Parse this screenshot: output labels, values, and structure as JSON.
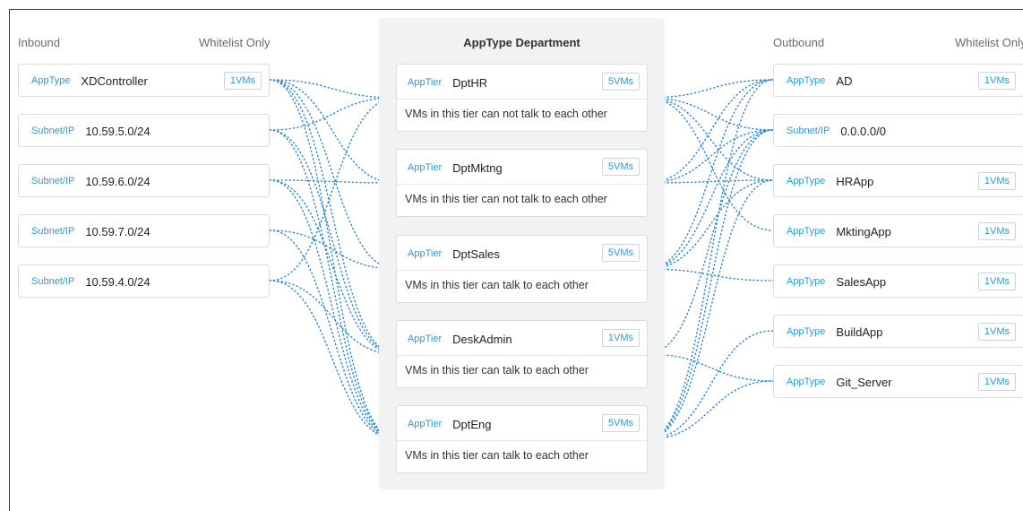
{
  "inbound": {
    "heading": "Inbound",
    "whitelist_label": "Whitelist Only",
    "items": [
      {
        "tag": "AppType",
        "name": "XDController",
        "vms": "1VMs"
      },
      {
        "tag": "Subnet/IP",
        "name": "10.59.5.0/24",
        "vms": ""
      },
      {
        "tag": "Subnet/IP",
        "name": "10.59.6.0/24",
        "vms": ""
      },
      {
        "tag": "Subnet/IP",
        "name": "10.59.7.0/24",
        "vms": ""
      },
      {
        "tag": "Subnet/IP",
        "name": "10.59.4.0/24",
        "vms": ""
      }
    ]
  },
  "center": {
    "title": "AppType Department",
    "tiers": [
      {
        "tag": "AppTier",
        "name": "DptHR",
        "vms": "5VMs",
        "desc": "VMs in this tier can not talk to each other"
      },
      {
        "tag": "AppTier",
        "name": "DptMktng",
        "vms": "5VMs",
        "desc": "VMs in this tier can not talk to each other"
      },
      {
        "tag": "AppTier",
        "name": "DptSales",
        "vms": "5VMs",
        "desc": "VMs in this tier can talk to each other"
      },
      {
        "tag": "AppTier",
        "name": "DeskAdmin",
        "vms": "1VMs",
        "desc": "VMs in this tier can talk to each other"
      },
      {
        "tag": "AppTier",
        "name": "DptEng",
        "vms": "5VMs",
        "desc": "VMs in this tier can talk to each other"
      }
    ]
  },
  "outbound": {
    "heading": "Outbound",
    "whitelist_label": "Whitelist Only",
    "items": [
      {
        "tag": "AppType",
        "name": "AD",
        "vms": "1VMs"
      },
      {
        "tag": "Subnet/IP",
        "name": "0.0.0.0/0",
        "vms": ""
      },
      {
        "tag": "AppType",
        "name": "HRApp",
        "vms": "1VMs"
      },
      {
        "tag": "AppType",
        "name": "MktingApp",
        "vms": "1VMs"
      },
      {
        "tag": "AppType",
        "name": "SalesApp",
        "vms": "1VMs"
      },
      {
        "tag": "AppType",
        "name": "BuildApp",
        "vms": "1VMs"
      },
      {
        "tag": "AppType",
        "name": "Git_Server",
        "vms": "1VMs"
      }
    ]
  },
  "links": {
    "inbound_to_tier": [
      [
        0,
        0
      ],
      [
        0,
        1
      ],
      [
        0,
        2
      ],
      [
        0,
        3
      ],
      [
        0,
        4
      ],
      [
        1,
        0
      ],
      [
        2,
        1
      ],
      [
        3,
        2
      ],
      [
        4,
        3
      ],
      [
        1,
        4
      ],
      [
        2,
        3
      ],
      [
        3,
        4
      ],
      [
        4,
        0
      ],
      [
        1,
        3
      ],
      [
        2,
        4
      ],
      [
        4,
        4
      ]
    ],
    "tier_to_outbound": [
      [
        0,
        0
      ],
      [
        0,
        1
      ],
      [
        0,
        2
      ],
      [
        0,
        3
      ],
      [
        1,
        0
      ],
      [
        1,
        1
      ],
      [
        2,
        0
      ],
      [
        2,
        1
      ],
      [
        2,
        4
      ],
      [
        3,
        6
      ],
      [
        4,
        0
      ],
      [
        4,
        1
      ],
      [
        4,
        5
      ],
      [
        4,
        6
      ],
      [
        3,
        1
      ],
      [
        1,
        2
      ],
      [
        2,
        2
      ],
      [
        4,
        2
      ]
    ]
  },
  "colors": {
    "accent": "#2a9bd6",
    "link": "#2a86d6",
    "panel": "#f1f2f4"
  }
}
